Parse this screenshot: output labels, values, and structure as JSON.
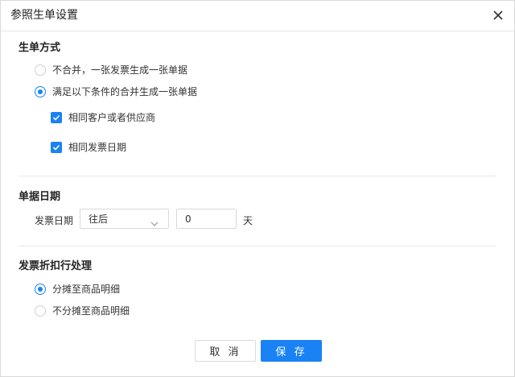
{
  "dialog": {
    "title": "参照生单设置",
    "close_icon": "close-icon"
  },
  "generation": {
    "title": "生单方式",
    "options": [
      {
        "label": "不合并，一张发票生成一张单据",
        "checked": false
      },
      {
        "label": "满足以下条件的合并生成一张单据",
        "checked": true
      }
    ],
    "conditions": [
      {
        "label": "相同客户或者供应商",
        "checked": true
      },
      {
        "label": "相同发票日期",
        "checked": true
      }
    ]
  },
  "doc_date": {
    "title": "单据日期",
    "field_label": "发票日期",
    "direction": "往后",
    "offset_value": "0",
    "unit": "天"
  },
  "discount": {
    "title": "发票折扣行处理",
    "options": [
      {
        "label": "分摊至商品明细",
        "checked": true
      },
      {
        "label": "不分摊至商品明细",
        "checked": false
      }
    ]
  },
  "footer": {
    "cancel_label": "取 消",
    "save_label": "保 存"
  },
  "colors": {
    "accent": "#1a82f5",
    "border": "#d9d9d9"
  }
}
